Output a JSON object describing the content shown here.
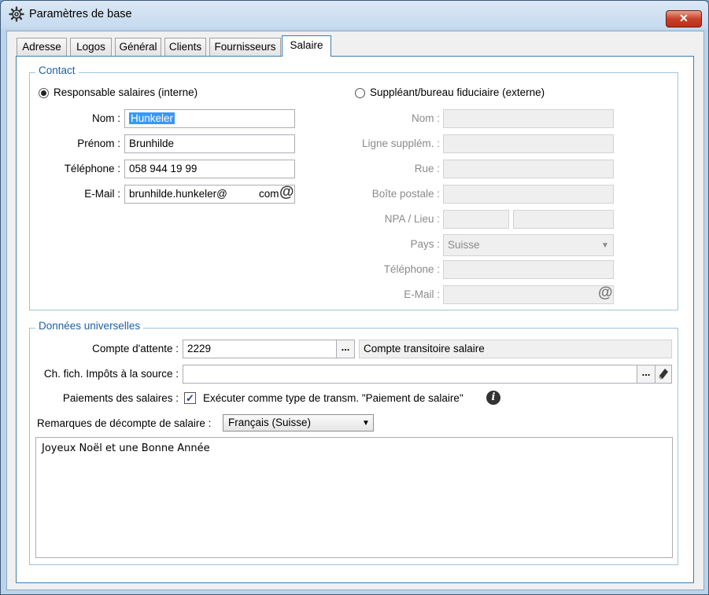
{
  "window": {
    "title": "Paramètres de base",
    "close_label": "✕"
  },
  "tabs": [
    {
      "label": "Adresse"
    },
    {
      "label": "Logos"
    },
    {
      "label": "Général"
    },
    {
      "label": "Clients"
    },
    {
      "label": "Fournisseurs"
    },
    {
      "label": "Salaire",
      "active": true
    }
  ],
  "contact": {
    "legend": "Contact",
    "internal": {
      "radio_label": "Responsable salaires (interne)",
      "selected": true,
      "nom_label": "Nom :",
      "nom_value": "Hunkeler",
      "prenom_label": "Prénom :",
      "prenom_value": "Brunhilde",
      "telephone_label": "Téléphone :",
      "telephone_value": "058 944 19 99",
      "email_label": "E-Mail :",
      "email_value": "brunhilde.hunkeler@",
      "email_value_end": "com",
      "email_icon": "at-icon"
    },
    "external": {
      "radio_label": "Suppléant/bureau fiduciaire (externe)",
      "selected": false,
      "nom_label": "Nom :",
      "ligne_label": "Ligne supplém. :",
      "rue_label": "Rue :",
      "boite_label": "Boîte postale :",
      "npa_label": "NPA / Lieu :",
      "pays_label": "Pays :",
      "pays_value": "Suisse",
      "telephone_label": "Téléphone :",
      "email_label": "E-Mail :",
      "email_icon": "at-icon"
    }
  },
  "universal": {
    "legend": "Données universelles",
    "compte_label": "Compte d'attente :",
    "compte_value": "2229",
    "compte_button": "...",
    "compte_desc": "Compte transitoire salaire",
    "impots_label": "Ch. fich. Impôts à la source :",
    "impots_value": "",
    "impots_button": "...",
    "paiements_label": "Paiements des salaires :",
    "paiements_checked": true,
    "paiements_checkbox_label": "Exécuter comme type de transm. \"Paiement de salaire\"",
    "remarques_label": "Remarques de décompte de salaire :",
    "language_value": "Français (Suisse)",
    "remarks_text": "Joyeux Noël et une Bonne Année"
  },
  "colors": {
    "accent": "#3c7fb1",
    "legend": "#1f5fa0",
    "selection": "#3399ff",
    "close": "#c8412a"
  }
}
